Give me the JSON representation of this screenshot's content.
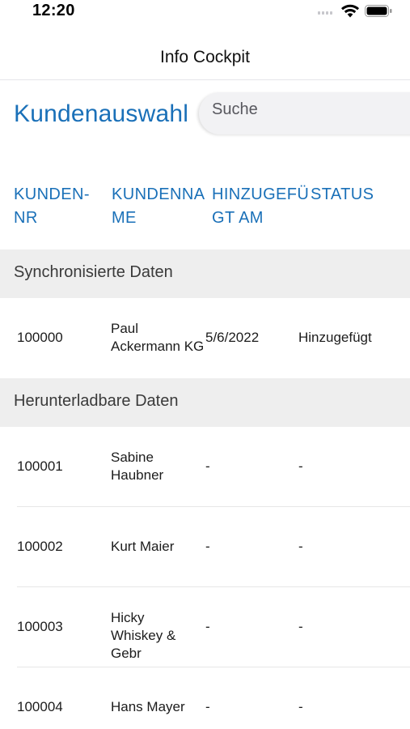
{
  "status_bar": {
    "time": "12:20",
    "icons": [
      "cellular-signal-icon",
      "wifi-icon",
      "battery-icon"
    ]
  },
  "nav": {
    "title": "Info Cockpit"
  },
  "page": {
    "title": "Kundenauswahl"
  },
  "search": {
    "placeholder": "Suche",
    "value": ""
  },
  "columns": [
    {
      "label": "KUNDEN-\nNR"
    },
    {
      "label": "KUNDENNA\nME"
    },
    {
      "label": "HINZUGEFÜ\nGT AM"
    },
    {
      "label": "STATUS"
    }
  ],
  "sections": [
    {
      "label": "Synchronisierte Daten",
      "rows": [
        {
          "id": "100000",
          "name": "Paul\nAckermann KG",
          "added": "5/6/2022",
          "status": "Hinzugefügt"
        }
      ]
    },
    {
      "label": "Herunterladbare Daten",
      "rows": [
        {
          "id": "100001",
          "name": "Sabine\nHaubner",
          "added": "-",
          "status": "-"
        },
        {
          "id": "100002",
          "name": "Kurt Maier",
          "added": "-",
          "status": "-"
        },
        {
          "id": "100003",
          "name": "Hicky\nWhiskey & Gebr",
          "added": "-",
          "status": "-"
        },
        {
          "id": "100004",
          "name": "Hans Mayer",
          "added": "-",
          "status": "-"
        }
      ]
    }
  ],
  "colors": {
    "accent": "#1a70b8",
    "section_bg": "#eeeeee"
  }
}
